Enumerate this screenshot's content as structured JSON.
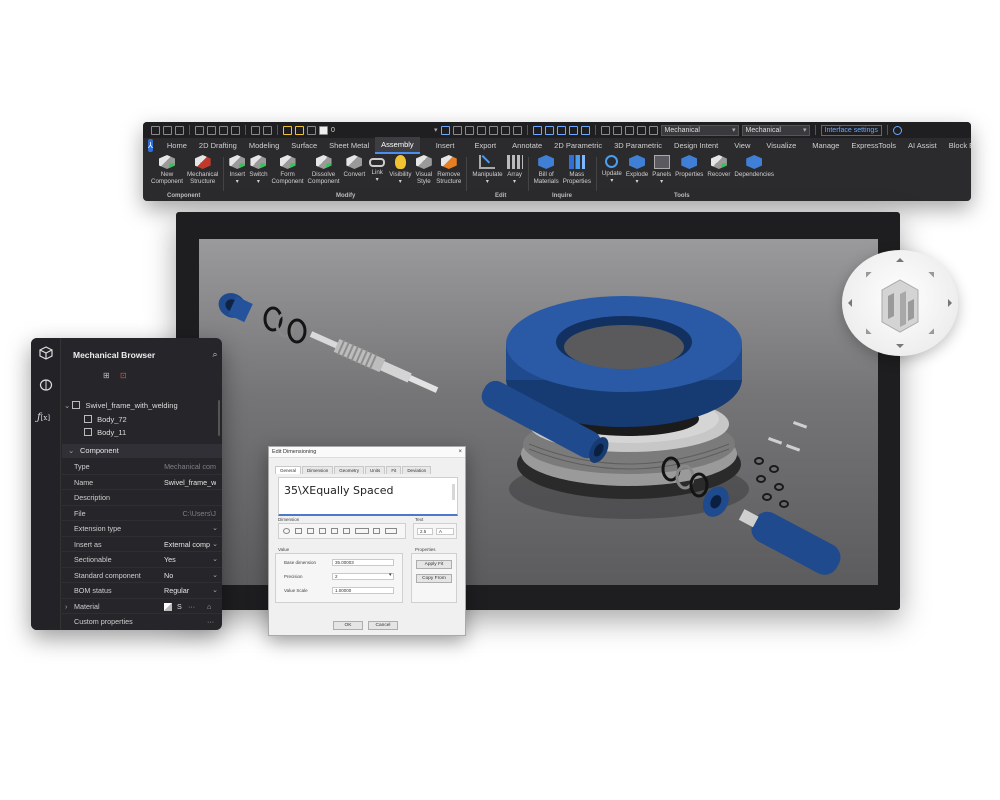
{
  "ribbon": {
    "qat": {
      "layer_value": "0",
      "workspace_combo": "Mechanical",
      "workspace_combo2": "Mechanical",
      "interface_settings_label": "Interface settings"
    },
    "app_logo": "⅄",
    "tabs": [
      "Home",
      "2D Drafting",
      "Modeling",
      "Surface",
      "Sheet Metal",
      "Assembly",
      "Insert",
      "Export",
      "Annotate",
      "2D Parametric",
      "3D Parametric",
      "Design Intent",
      "View",
      "Visualize",
      "Manage",
      "ExpressTools",
      "AI Assist",
      "Block Editor"
    ],
    "active_tab": "Assembly",
    "buttons": {
      "new_component": [
        "New",
        "Component"
      ],
      "mechanical_structure": [
        "Mechanical",
        "Structure"
      ],
      "insert": [
        "Insert"
      ],
      "switch": [
        "Switch"
      ],
      "form_component": [
        "Form",
        "Component"
      ],
      "dissolve_component": [
        "Dissolve",
        "Component"
      ],
      "convert": [
        "Convert"
      ],
      "link": [
        "Link"
      ],
      "visibility": [
        "Visibility"
      ],
      "visual_style": [
        "Visual",
        "Style"
      ],
      "remove_structure": [
        "Remove",
        "Structure"
      ],
      "manipulate": [
        "Manipulate"
      ],
      "array": [
        "Array"
      ],
      "bill_of_materials": [
        "Bill of",
        "Materials"
      ],
      "mass_properties": [
        "Mass",
        "Properties"
      ],
      "update": [
        "Update"
      ],
      "explode": [
        "Explode"
      ],
      "panels": [
        "Panels"
      ],
      "properties": [
        "Properties"
      ],
      "recover": [
        "Recover"
      ],
      "dependencies": [
        "Dependencies"
      ]
    },
    "groups": {
      "component": "Component",
      "modify": "Modify",
      "edit": "Edit",
      "inquire": "Inquire",
      "tools": "Tools"
    }
  },
  "browser": {
    "title": "Mechanical Browser",
    "tree": {
      "root": "Swivel_frame_with_welding",
      "children": [
        "Body_72",
        "Body_11"
      ]
    },
    "section": "Component",
    "properties": [
      {
        "key": "Type",
        "value": "Mechanical com",
        "dim": true,
        "dropdown": false
      },
      {
        "key": "Name",
        "value": "Swivel_frame_with",
        "dim": false,
        "dropdown": false
      },
      {
        "key": "Description",
        "value": "",
        "dim": false,
        "dropdown": false
      },
      {
        "key": "File",
        "value": "C:\\Users\\J",
        "dim": true,
        "dropdown": false
      },
      {
        "key": "Extension type",
        "value": "",
        "dim": false,
        "dropdown": true
      },
      {
        "key": "Insert as",
        "value": "External comp",
        "dim": false,
        "dropdown": true
      },
      {
        "key": "Sectionable",
        "value": "Yes",
        "dim": false,
        "dropdown": true
      },
      {
        "key": "Standard component",
        "value": "No",
        "dim": false,
        "dropdown": true
      },
      {
        "key": "BOM status",
        "value": "Regular",
        "dim": false,
        "dropdown": true
      },
      {
        "key": "Material",
        "value": "S",
        "dim": false,
        "dropdown": false
      },
      {
        "key": "Custom properties",
        "value": "",
        "dim": false,
        "dropdown": false
      }
    ],
    "more_glyph": "···"
  },
  "dialog": {
    "title": "Edit Dimensioning",
    "close_glyph": "×",
    "tabs": [
      "General",
      "Dimension",
      "Geometry",
      "Units",
      "Fit",
      "Deviation"
    ],
    "edit_text": "35\\XEqually Spaced",
    "section_symbols": "Dimension",
    "section_text": "Text",
    "text_height": "2.5",
    "text_font": "A",
    "section_value": "Value",
    "section_properties": "Properties",
    "fields": [
      {
        "label": "Base dimension",
        "value": "35.00003"
      },
      {
        "label": "Precision",
        "value": "2"
      },
      {
        "label": "Value Scale",
        "value": "1.00000"
      }
    ],
    "apply_label": "Apply Fit",
    "copy_label": "Copy From",
    "ok_label": "OK",
    "cancel_label": "Cancel"
  },
  "colors": {
    "ribbon_bg": "#2b2b2e",
    "accent_blue": "#2f6fd6",
    "part_blue": "#1f4a8e",
    "browser_bg": "#26262a"
  }
}
